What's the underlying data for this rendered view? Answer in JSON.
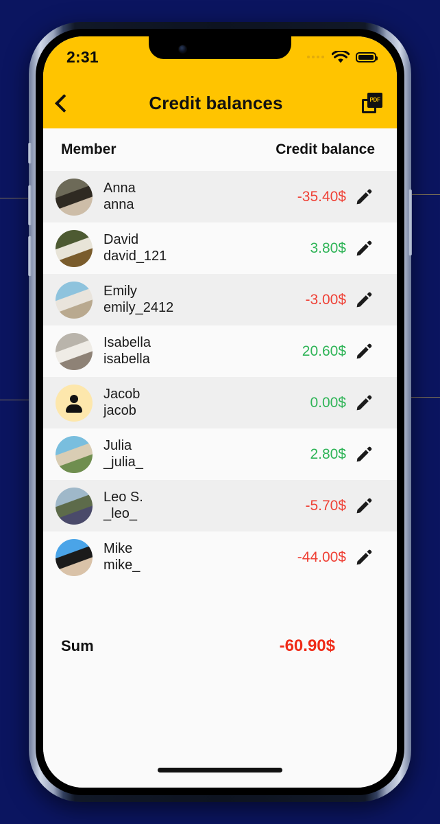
{
  "theme": {
    "accent": "#FFC400",
    "negative": "#ef4136",
    "positive": "#2fb457",
    "sum_negative": "#ef2b18",
    "page_background": "#0b1560",
    "row_alt": "#efefef",
    "row_plain": "#fafafa"
  },
  "status_bar": {
    "time": "2:31",
    "signal_icon": "signal-dots-icon",
    "wifi_icon": "wifi-icon",
    "battery_icon": "battery-full-icon"
  },
  "nav": {
    "back_icon": "chevron-left-icon",
    "title": "Credit balances",
    "pdf_icon": "pdf-export-icon",
    "pdf_label": "PDF"
  },
  "table": {
    "headers": {
      "member": "Member",
      "balance": "Credit balance"
    },
    "edit_icon": "pencil-icon",
    "rows": [
      {
        "name": "Anna",
        "username": "anna",
        "amount": "-35.40$",
        "sign": "neg",
        "avatar_type": "photo",
        "avatar_colors": [
          "#6d6a58",
          "#2f2a22",
          "#cdbda8"
        ]
      },
      {
        "name": "David",
        "username": "david_121",
        "amount": "3.80$",
        "sign": "pos",
        "avatar_type": "photo",
        "avatar_colors": [
          "#4d5a32",
          "#e8e4d8",
          "#7a5c2c"
        ]
      },
      {
        "name": "Emily",
        "username": "emily_2412",
        "amount": "-3.00$",
        "sign": "neg",
        "avatar_type": "photo",
        "avatar_colors": [
          "#8ec3dd",
          "#e9e4dc",
          "#b9a98f"
        ]
      },
      {
        "name": "Isabella",
        "username": "isabella",
        "amount": "20.60$",
        "sign": "pos",
        "avatar_type": "photo",
        "avatar_colors": [
          "#b9b4ab",
          "#efece6",
          "#8e8276"
        ]
      },
      {
        "name": "Jacob",
        "username": "jacob",
        "amount": "0.00$",
        "sign": "pos",
        "avatar_type": "placeholder",
        "avatar_colors": [
          "#fde7ac",
          "#fde7ac",
          "#fde7ac"
        ]
      },
      {
        "name": "Julia",
        "username": "_julia_",
        "amount": "2.80$",
        "sign": "pos",
        "avatar_type": "photo",
        "avatar_colors": [
          "#79bede",
          "#d9cdb4",
          "#6f8e4f"
        ]
      },
      {
        "name": "Leo S.",
        "username": "_leo_",
        "amount": "-5.70$",
        "sign": "neg",
        "avatar_type": "photo",
        "avatar_colors": [
          "#9fb8c9",
          "#5d6b4a",
          "#4a4a6a"
        ]
      },
      {
        "name": "Mike",
        "username": "mike_",
        "amount": "-44.00$",
        "sign": "neg",
        "avatar_type": "photo",
        "avatar_colors": [
          "#4aa4e8",
          "#1b1b1b",
          "#d9c2a8"
        ]
      }
    ],
    "sum": {
      "label": "Sum",
      "value": "-60.90$"
    }
  }
}
